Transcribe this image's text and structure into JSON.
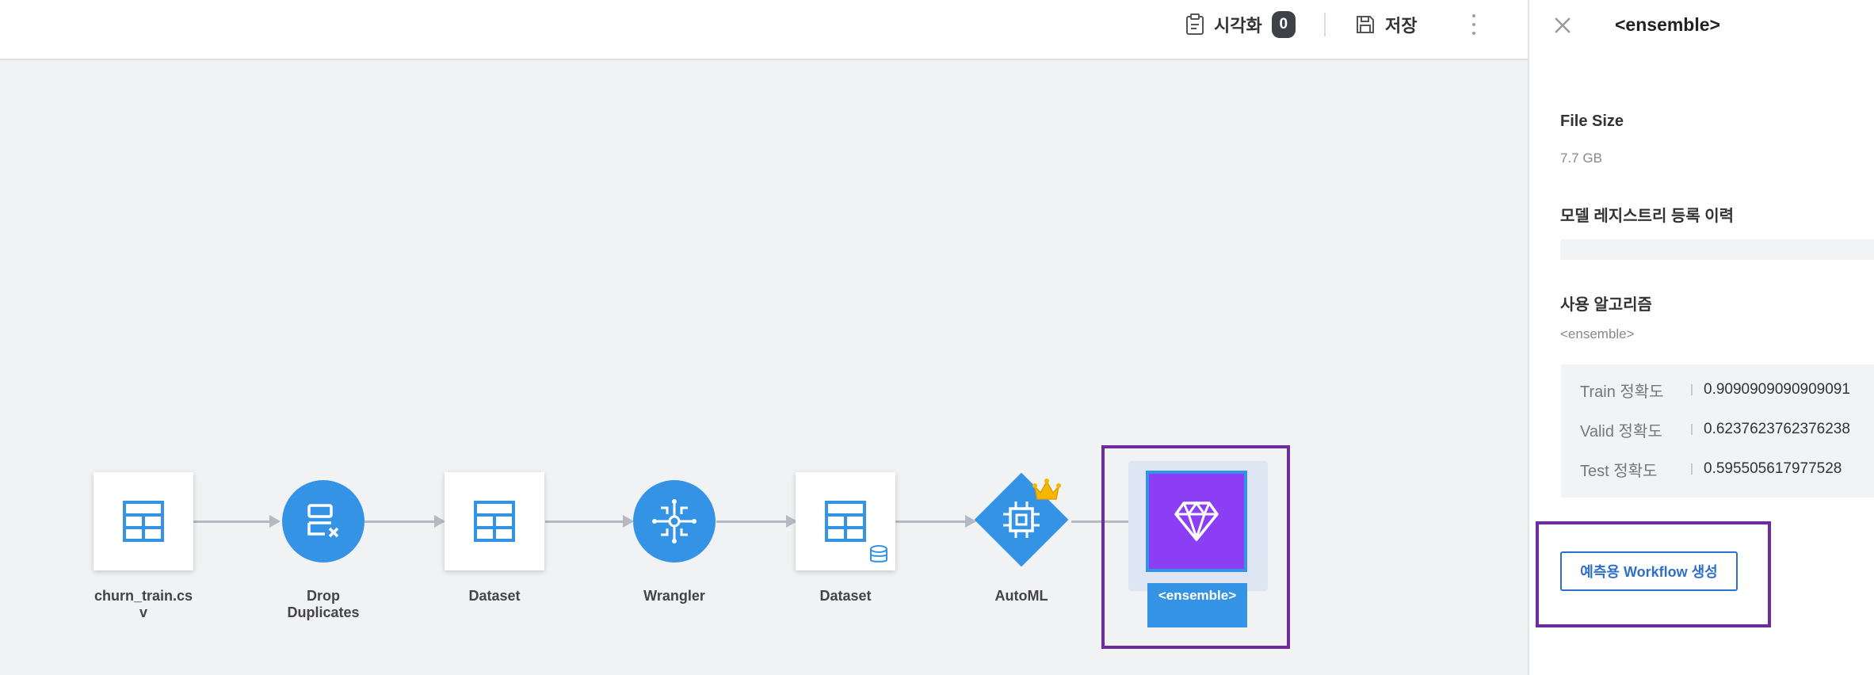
{
  "toolbar": {
    "visualize_label": "시각화",
    "visualize_count": "0",
    "save_label": "저장"
  },
  "flow": {
    "nodes": [
      {
        "label": "churn_train.csv",
        "label_line1": "churn_train.cs",
        "label_line2": "v",
        "icon": "table-icon"
      },
      {
        "label": "Drop Duplicates",
        "label_line1": "Drop",
        "label_line2": "Duplicates",
        "icon": "drop-duplicates-icon"
      },
      {
        "label": "Dataset",
        "icon": "table-icon"
      },
      {
        "label": "Wrangler",
        "icon": "wrangler-icon"
      },
      {
        "label": "Dataset",
        "icon": "table-database-icon"
      },
      {
        "label": "AutoML",
        "icon": "chip-icon"
      },
      {
        "label": "<ensemble>",
        "icon": "diamond-gem-icon"
      }
    ]
  },
  "panel": {
    "title": "<ensemble>",
    "file_size_title": "File Size",
    "file_size_value": "7.7 GB",
    "registry_title": "모델 레지스트리 등록 이력",
    "algorithm_title": "사용 알고리즘",
    "algorithm_value": "<ensemble>",
    "metrics": [
      {
        "name": "Train 정확도",
        "value": "0.9090909090909091"
      },
      {
        "name": "Valid 정확도",
        "value": "0.6237623762376238"
      },
      {
        "name": "Test 정확도",
        "value": "0.595505617977528"
      }
    ],
    "create_workflow_label": "예측용 Workflow 생성"
  },
  "colors": {
    "accent_blue": "#3593e6",
    "ensemble_purple": "#8c3ef4",
    "highlight_purple": "#6e2b9f",
    "button_blue": "#2d6fcb"
  }
}
